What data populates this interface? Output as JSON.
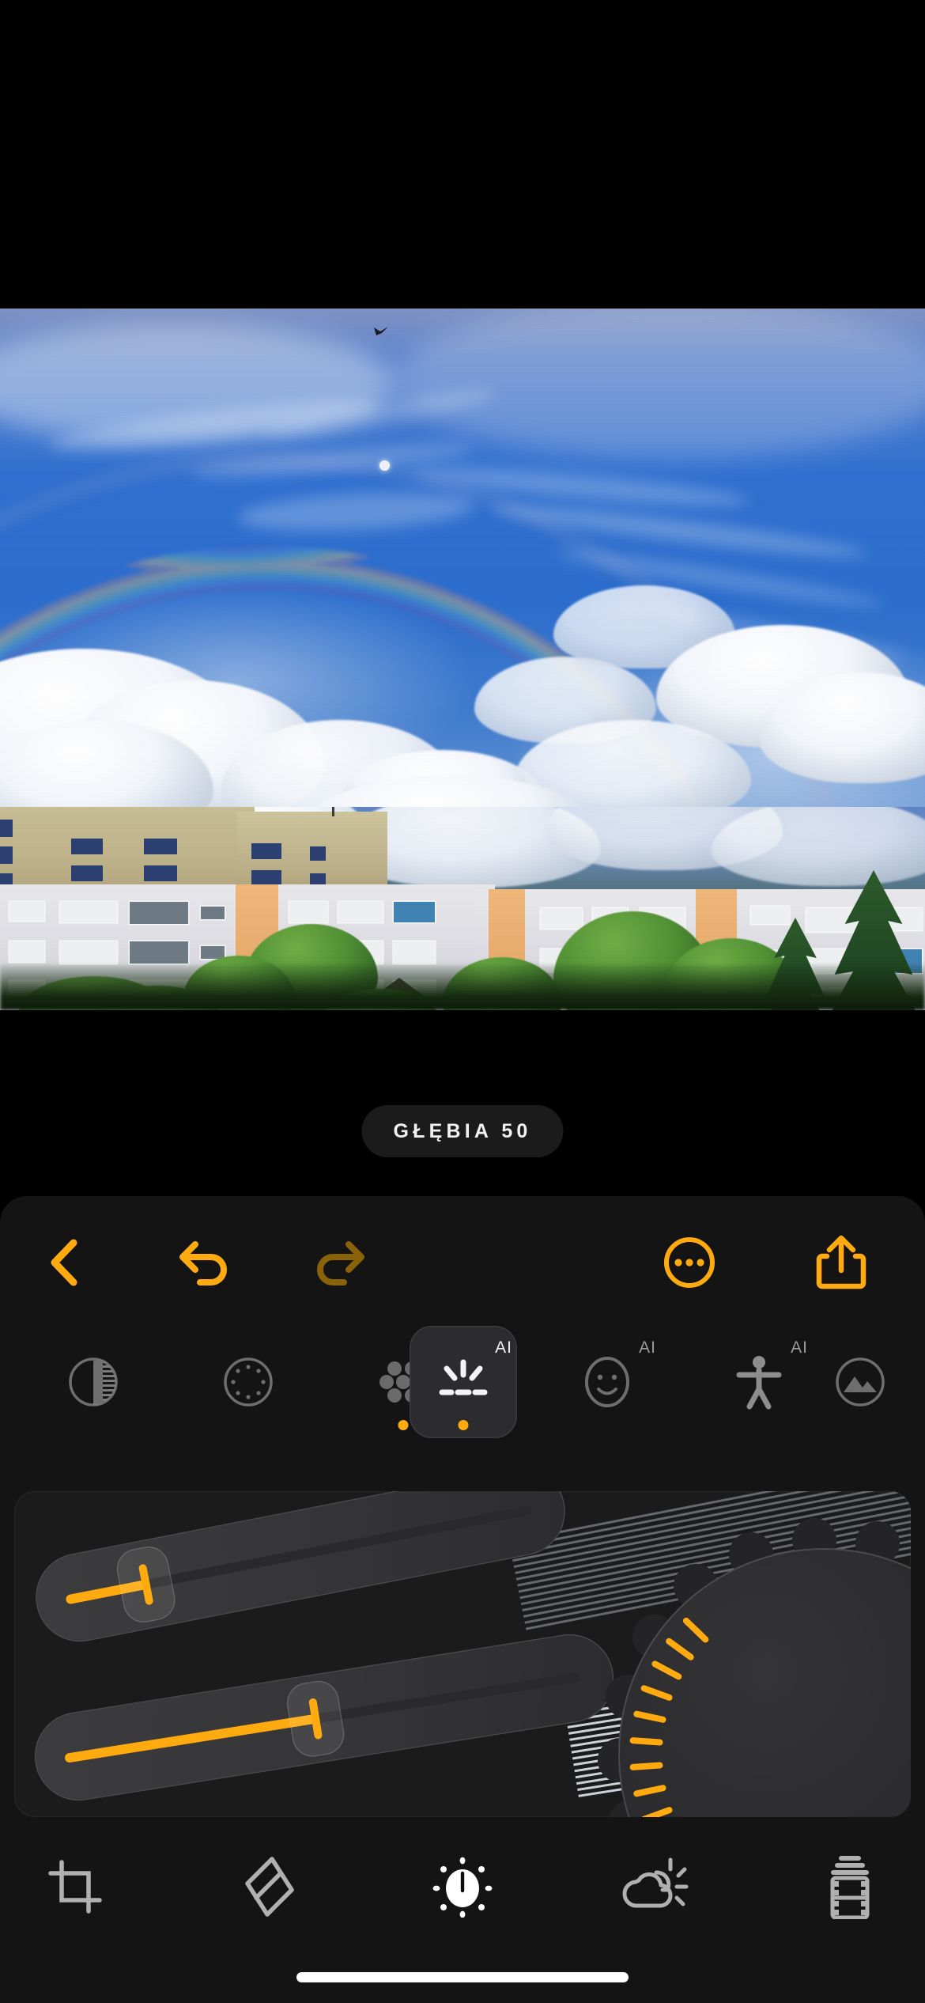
{
  "app": {
    "name": "photo-editor",
    "accent": "#ffab10",
    "panel_bg": "#141414",
    "card_bg": "#1b1b1b"
  },
  "photo": {
    "alt": "Blue sky with rainbow and clouds over apartment blocks and green trees",
    "subject_tags": [
      "sky",
      "rainbow",
      "clouds",
      "bird",
      "moon",
      "apartment-buildings",
      "trees"
    ]
  },
  "value_badge": {
    "label": "GŁĘBIA 50",
    "parameter": "GŁĘBIA",
    "value": "50"
  },
  "top_toolbar": {
    "items": [
      {
        "name": "back",
        "icon": "chevron-left-icon",
        "label": "Wstecz",
        "enabled": true,
        "color": "#ffab10"
      },
      {
        "name": "undo",
        "icon": "undo-icon",
        "label": "Cofnij",
        "enabled": true,
        "color": "#ffab10"
      },
      {
        "name": "redo",
        "icon": "redo-icon",
        "label": "Ponów",
        "enabled": false,
        "color": "#8a6208"
      },
      {
        "name": "more",
        "icon": "more-circle-icon",
        "label": "Więcej",
        "enabled": true,
        "color": "#ffab10"
      },
      {
        "name": "share",
        "icon": "share-icon",
        "label": "Udostępnij",
        "enabled": true,
        "color": "#ffab10"
      }
    ]
  },
  "tool_row": {
    "items": [
      {
        "name": "contrast",
        "icon": "contrast-icon",
        "label": "Kontrast",
        "ai": false,
        "active": false,
        "selected": false
      },
      {
        "name": "vignette",
        "icon": "vignette-icon",
        "label": "Winieta",
        "ai": false,
        "active": false,
        "selected": false
      },
      {
        "name": "bokeh",
        "icon": "bokeh-icon",
        "label": "Bokeh",
        "ai": true,
        "ai_label": "AI",
        "active": true,
        "selected": false
      },
      {
        "name": "depth",
        "icon": "depth-burst-icon",
        "label": "Głębia",
        "ai": true,
        "ai_label": "AI",
        "active": true,
        "selected": true
      },
      {
        "name": "face",
        "icon": "face-icon",
        "label": "Twarz",
        "ai": true,
        "ai_label": "AI",
        "active": false,
        "selected": false
      },
      {
        "name": "body",
        "icon": "body-icon",
        "label": "Sylwetka",
        "ai": true,
        "ai_label": "AI",
        "active": false,
        "selected": false
      },
      {
        "name": "landscape",
        "icon": "landscape-icon",
        "label": "Krajobraz",
        "ai": false,
        "active": false,
        "selected": false
      }
    ]
  },
  "control_card": {
    "state": "transition",
    "sliders": [
      {
        "name": "slider-upper",
        "value_percent": 28,
        "accent": "#ffab10"
      },
      {
        "name": "slider-lower",
        "value_percent": 50,
        "accent": "#ffab10"
      }
    ],
    "dial": {
      "name": "radial-dial",
      "tick_count": 17,
      "accent": "#ffab10"
    }
  },
  "bottom_nav": {
    "items": [
      {
        "name": "crop",
        "icon": "crop-icon",
        "label": "Kadruj",
        "selected": false
      },
      {
        "name": "retouch",
        "icon": "eraser-icon",
        "label": "Retusz",
        "selected": false
      },
      {
        "name": "adjust",
        "icon": "brightness-dial-icon",
        "label": "Dostosuj",
        "selected": true
      },
      {
        "name": "effects",
        "icon": "weather-cloud-sun-icon",
        "label": "Efekty",
        "selected": false
      },
      {
        "name": "film",
        "icon": "film-strip-icon",
        "label": "Film",
        "selected": false
      }
    ]
  },
  "system": {
    "home_indicator": "home-indicator"
  }
}
